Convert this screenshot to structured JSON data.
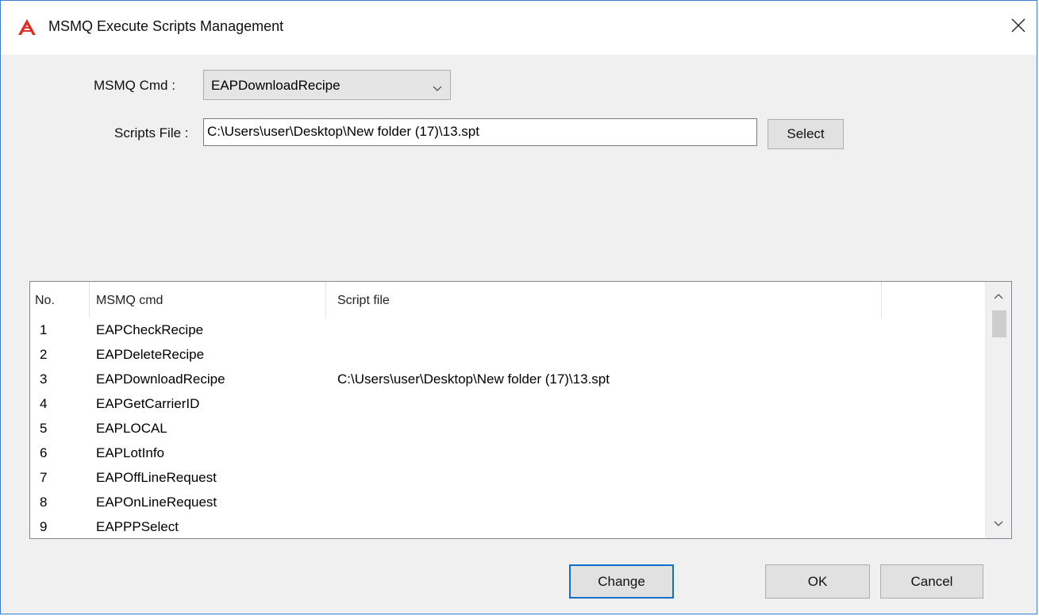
{
  "window": {
    "title": "MSMQ Execute Scripts Management"
  },
  "form": {
    "cmd_label": "MSMQ Cmd :",
    "cmd_selected": "EAPDownloadRecipe",
    "file_label": "Scripts File :",
    "file_value": "C:\\Users\\user\\Desktop\\New folder (17)\\13.spt",
    "select_label": "Select"
  },
  "list": {
    "columns": [
      "No.",
      "MSMQ cmd",
      "Script file",
      ""
    ],
    "rows": [
      {
        "no": "1",
        "cmd": "EAPCheckRecipe",
        "file": ""
      },
      {
        "no": "2",
        "cmd": "EAPDeleteRecipe",
        "file": ""
      },
      {
        "no": "3",
        "cmd": "EAPDownloadRecipe",
        "file": "C:\\Users\\user\\Desktop\\New folder (17)\\13.spt"
      },
      {
        "no": "4",
        "cmd": "EAPGetCarrierID",
        "file": ""
      },
      {
        "no": "5",
        "cmd": "EAPLOCAL",
        "file": ""
      },
      {
        "no": "6",
        "cmd": "EAPLotInfo",
        "file": ""
      },
      {
        "no": "7",
        "cmd": "EAPOffLineRequest",
        "file": ""
      },
      {
        "no": "8",
        "cmd": "EAPOnLineRequest",
        "file": ""
      },
      {
        "no": "9",
        "cmd": "EAPPPSelect",
        "file": ""
      }
    ]
  },
  "buttons": {
    "change": "Change",
    "ok": "OK",
    "cancel": "Cancel"
  },
  "icons": {
    "app": "app-logo-icon",
    "close": "close-icon",
    "dropdown": "chevron-down-icon",
    "scroll_up": "chevron-up-icon",
    "scroll_down": "chevron-down-icon"
  },
  "colors": {
    "accent_border": "#3a7bd5",
    "logo": "#d9312a",
    "focus": "#0f6fd1"
  }
}
